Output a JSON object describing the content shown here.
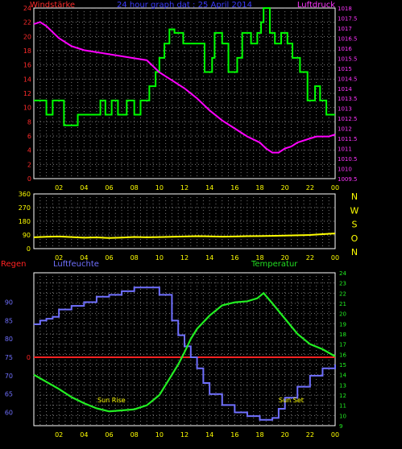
{
  "colors": {
    "background": "#000000",
    "frame": "#ffffff",
    "grid": "#7a7a7a",
    "tick_time": "#ffff00",
    "wind_axis": "#ff2b2b",
    "pressure_axis": "#ff33ff",
    "title": "#3b3bff",
    "wind": "#00ff00",
    "pressure": "#ff00ff",
    "winddir": "#ffff00",
    "compass": "#ffff00",
    "regen": "#ff2222",
    "humidity": "#7070ff",
    "temperature": "#22ee22",
    "label_temperature": "#22dd22",
    "sun_labels": "#ffff00"
  },
  "chart_data": [
    {
      "type": "line",
      "title": "24 hour graph dat : 25 April 2014",
      "left_axis_label": "Windstärke",
      "right_axis_label": "Luftdruck",
      "x_ticks": [
        "02",
        "04",
        "06",
        "08",
        "10",
        "12",
        "14",
        "16",
        "18",
        "20",
        "22",
        "00"
      ],
      "xlim": [
        0,
        24
      ],
      "left_ylim": [
        0,
        24
      ],
      "left_ticks": [
        "0",
        "2",
        "4",
        "6",
        "8",
        "10",
        "12",
        "14",
        "16",
        "18",
        "20",
        "22",
        "24"
      ],
      "right_ylim": [
        1009.5,
        1018
      ],
      "right_ticks": [
        "1009.5",
        "1010",
        "1010.5",
        "1011",
        "1011.5",
        "1012",
        "1012.5",
        "1013",
        "1013.5",
        "1014",
        "1014.5",
        "1015",
        "1015.5",
        "1016",
        "1016.5",
        "1017",
        "1017.5",
        "1018"
      ],
      "grid": true,
      "series": [
        {
          "name": "Windstärke",
          "axis": "left",
          "step": true,
          "x": [
            0,
            1.0,
            1.5,
            2.4,
            3.5,
            5.3,
            5.7,
            6.2,
            6.7,
            7.4,
            8.0,
            8.5,
            9.2,
            9.7,
            10.0,
            10.4,
            10.8,
            11.2,
            11.9,
            13.6,
            14.2,
            14.4,
            15.0,
            15.5,
            16.2,
            16.6,
            17.3,
            17.8,
            18.1,
            18.3,
            18.8,
            19.2,
            19.7,
            20.2,
            20.6,
            21.2,
            21.8,
            22.4,
            22.8,
            23.3,
            24.0
          ],
          "values": [
            11,
            9,
            11,
            7.5,
            9,
            11,
            9,
            11,
            9,
            11,
            9,
            11,
            13,
            15,
            17,
            19,
            21,
            20.5,
            19,
            15,
            17,
            20.5,
            19,
            15,
            17,
            20.5,
            19,
            20.5,
            22,
            24,
            20.5,
            19,
            20.5,
            19,
            17,
            15,
            11,
            13,
            11,
            9,
            9
          ]
        },
        {
          "name": "Luftdruck",
          "axis": "right",
          "x": [
            0,
            0.5,
            1.0,
            1.5,
            2.0,
            3.0,
            4.0,
            5.0,
            6.0,
            7.0,
            8.0,
            9.0,
            10.0,
            11.0,
            12.0,
            13.0,
            14.0,
            15.0,
            16.0,
            17.0,
            18.0,
            18.5,
            19.0,
            19.5,
            20.0,
            20.5,
            21.0,
            21.5,
            22.0,
            22.5,
            23.0,
            23.5,
            24.0
          ],
          "values": [
            1017.2,
            1017.3,
            1017.1,
            1016.8,
            1016.5,
            1016.1,
            1015.9,
            1015.8,
            1015.7,
            1015.6,
            1015.5,
            1015.4,
            1014.8,
            1014.4,
            1014.0,
            1013.5,
            1012.9,
            1012.4,
            1012.0,
            1011.6,
            1011.3,
            1011.0,
            1010.8,
            1010.8,
            1011.0,
            1011.1,
            1011.3,
            1011.4,
            1011.5,
            1011.6,
            1011.6,
            1011.6,
            1011.7
          ]
        }
      ]
    },
    {
      "type": "line",
      "right_axis_label": [
        "N",
        "W",
        "S",
        "O",
        "N"
      ],
      "x_ticks": [
        "02",
        "04",
        "06",
        "08",
        "10",
        "12",
        "14",
        "16",
        "18",
        "20",
        "22",
        "00"
      ],
      "xlim": [
        0,
        24
      ],
      "ylim": [
        0,
        360
      ],
      "left_ticks": [
        "0",
        "90",
        "180",
        "270",
        "360"
      ],
      "grid": true,
      "series": [
        {
          "name": "Windrichtung",
          "x": [
            0,
            1,
            2,
            3,
            4,
            5,
            6,
            7,
            8,
            9,
            10,
            11,
            12,
            13,
            14,
            15,
            16,
            17,
            18,
            19,
            20,
            21,
            22,
            23,
            24
          ],
          "values": [
            75,
            78,
            80,
            76,
            72,
            74,
            70,
            73,
            77,
            75,
            76,
            78,
            80,
            82,
            81,
            79,
            80,
            82,
            83,
            84,
            86,
            88,
            90,
            95,
            100
          ]
        }
      ]
    },
    {
      "type": "line",
      "labels": {
        "regen": "Regen",
        "humidity": "Luftfeuchte",
        "temperature": "Temperatur",
        "sunrise": "Sun Rise",
        "sunset": "Sun Set"
      },
      "x_ticks": [
        "02",
        "04",
        "06",
        "08",
        "10",
        "12",
        "14",
        "16",
        "18",
        "20",
        "22",
        "00"
      ],
      "xlim": [
        0,
        24
      ],
      "left_ylim": [
        56.4,
        98.0
      ],
      "left_ticks": [
        "60",
        "65",
        "70",
        "75",
        "80",
        "85",
        "90"
      ],
      "left_regen_tick": "0",
      "right_ylim": [
        9,
        24
      ],
      "right_ticks": [
        "9",
        "10",
        "11",
        "12",
        "13",
        "14",
        "15",
        "16",
        "17",
        "18",
        "19",
        "20",
        "21",
        "22",
        "23",
        "24"
      ],
      "grid": true,
      "series": [
        {
          "name": "Regen",
          "axis": "left",
          "x": [
            0,
            24
          ],
          "values": [
            0,
            0
          ],
          "plot_level": 75
        },
        {
          "name": "Luftfeuchte",
          "axis": "left",
          "step": true,
          "x": [
            0,
            0.5,
            1.0,
            1.5,
            2.0,
            3.0,
            4.0,
            5.0,
            6.0,
            7.0,
            8.0,
            9.0,
            10.0,
            11.0,
            11.5,
            12.0,
            12.5,
            13.0,
            13.5,
            14.0,
            15.0,
            16.0,
            17.0,
            18.0,
            19.0,
            19.5,
            20.0,
            21.0,
            22.0,
            23.0,
            24.0
          ],
          "values": [
            84,
            85,
            85.5,
            86,
            88,
            89,
            90,
            91.5,
            92,
            93,
            94,
            94,
            92,
            85,
            81,
            78,
            75,
            72,
            68,
            65,
            62,
            60,
            59,
            58,
            58.5,
            61,
            64,
            67,
            70,
            72,
            73
          ]
        },
        {
          "name": "Temperatur",
          "axis": "right",
          "x": [
            0,
            1,
            2,
            3,
            4,
            5,
            6,
            7,
            8,
            9,
            10,
            11,
            11.5,
            12,
            12.5,
            13,
            14,
            15,
            16,
            17,
            17.8,
            18.3,
            19,
            20,
            21,
            22,
            23,
            24
          ],
          "values": [
            14.0,
            13.3,
            12.6,
            11.8,
            11.2,
            10.7,
            10.4,
            10.5,
            10.6,
            11.0,
            12.0,
            14.0,
            15.0,
            16.2,
            17.5,
            18.5,
            19.8,
            20.8,
            21.1,
            21.2,
            21.5,
            22.0,
            21.0,
            19.5,
            18.0,
            17.0,
            16.5,
            15.8
          ]
        }
      ]
    }
  ]
}
